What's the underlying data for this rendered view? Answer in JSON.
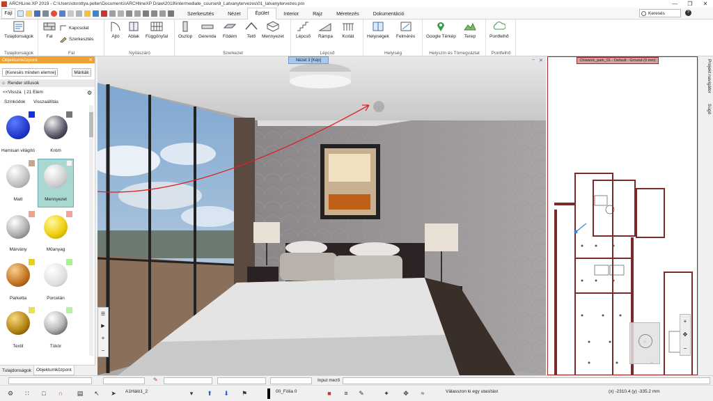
{
  "window": {
    "title": "ARCHLine.XP 2019 - C:\\Users\\dorottya.peller\\Documents\\ARCHlineXP Draw\\2018\\intermediate_course\\8_Latvanytervezes\\01_latvanytervezes.pro",
    "minimize_icon": "minimize-icon",
    "maximize_icon": "restore-icon",
    "close_icon": "close-icon"
  },
  "menu": {
    "file": "Fájl",
    "tabs": [
      "Szerkesztés",
      "Nézet",
      "Épület",
      "Interior",
      "Rajz",
      "Méretezés",
      "Dokumentáció"
    ],
    "active_tab": "Épület",
    "search_placeholder": "Keresés"
  },
  "ribbon": {
    "groups": [
      {
        "label": "Tulajdonságok",
        "buttons": [
          "Tulajdonságok"
        ]
      },
      {
        "label": "Fal",
        "buttons": [
          "Fal",
          "Kapcsolat",
          "Szerkesztés"
        ]
      },
      {
        "label": "Nyílászáró",
        "buttons": [
          "Ajtó",
          "Ablak",
          "Függönyfal"
        ]
      },
      {
        "label": "Szerkezet",
        "buttons": [
          "Oszlop",
          "Gerenda",
          "Födém",
          "Tető",
          "Mennyezet"
        ]
      },
      {
        "label": "Lépcső",
        "buttons": [
          "Lépcső",
          "Rámpa",
          "Korlát"
        ]
      },
      {
        "label": "Helyiség",
        "buttons": [
          "Helyiségek",
          "Felmérés"
        ]
      },
      {
        "label": "Helyszín és Tömegvázlat",
        "buttons": [
          "Google Térkép",
          "Terep"
        ]
      },
      {
        "label": "Pontfelhő",
        "buttons": [
          "Pontfelhő"
        ]
      }
    ]
  },
  "left_panel": {
    "title": "Objektumközpont",
    "search": "[Keresés minden elemre]",
    "marks_button": "Márkák",
    "style": "Render stílusok",
    "back": "<<Vissza",
    "count": "| 21 Elem",
    "color_codes": "Színkódok",
    "reset": "Visszaállítás",
    "materials": [
      "Hamisan világító",
      "Króm",
      "Matt",
      "Mennyezet",
      "Márvány",
      "Műanyag",
      "Parketta",
      "Porcelán",
      "Textil",
      "Tükör"
    ],
    "bottom_tabs": [
      "Tulajdonságok",
      "Objektumközpont"
    ]
  },
  "viewport": {
    "title": "Nézet 3 [Kép]"
  },
  "right_view": {
    "title": "Chiswick_park_01 - Default - Ground (0 mm)",
    "side_tabs": [
      "Projekt navigátor",
      "Súgó"
    ]
  },
  "status": {
    "input_label": "Input mező",
    "layer": "A1Háló1_2",
    "folia": "00_Fólia 0",
    "prompt": "Válasszon ki egy utasítást",
    "coords": "(x) -2310.4  (y) -335.2 mm"
  },
  "colors": {
    "accent": "#f0a030",
    "panel_title": "#f0a030",
    "view_border": "#9b2a2a"
  }
}
